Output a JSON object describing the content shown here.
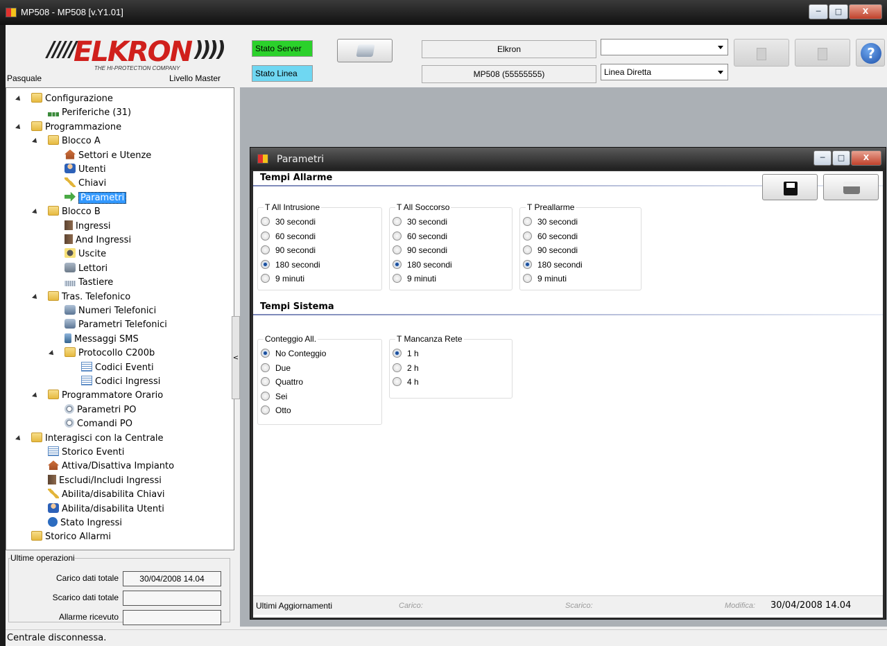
{
  "window": {
    "title": "MP508 - MP508 [v.Y1.01]"
  },
  "header": {
    "logo_text": "ELKRON",
    "logo_tagline": "THE HI-PROTECTION COMPANY",
    "user": "Pasquale",
    "level": "Livello Master",
    "stato_server": "Stato Server",
    "stato_linea": "Stato Linea",
    "stato_server_color": "#2bd12b",
    "stato_linea_color": "#6fd7f2",
    "central_name": "Elkron",
    "central_model": "MP508 (55555555)",
    "combo1_value": "",
    "line_type": "Linea Diretta"
  },
  "tree": [
    {
      "label": "Configurazione",
      "icon": "folder-icon"
    },
    {
      "label": "Periferiche (31)",
      "icon": "network-icon"
    },
    {
      "label": "Programmazione",
      "icon": "folder-icon"
    },
    {
      "label": "Blocco A",
      "icon": "folder-icon"
    },
    {
      "label": "Settori e Utenze",
      "icon": "house-icon"
    },
    {
      "label": "Utenti",
      "icon": "user-icon"
    },
    {
      "label": "Chiavi",
      "icon": "key-icon"
    },
    {
      "label": "Parametri",
      "icon": "green-arrow-icon"
    },
    {
      "label": "Blocco B",
      "icon": "folder-icon"
    },
    {
      "label": "Ingressi",
      "icon": "door-icon"
    },
    {
      "label": "And Ingressi",
      "icon": "door-icon"
    },
    {
      "label": "Uscite",
      "icon": "speaker-icon"
    },
    {
      "label": "Lettori",
      "icon": "reader-icon"
    },
    {
      "label": "Tastiere",
      "icon": "keyboard-icon"
    },
    {
      "label": "Tras. Telefonico",
      "icon": "folder-icon"
    },
    {
      "label": "Numeri Telefonici",
      "icon": "phone-icon"
    },
    {
      "label": "Parametri Telefonici",
      "icon": "phone-icon"
    },
    {
      "label": "Messaggi SMS",
      "icon": "sms-icon"
    },
    {
      "label": "Protocollo C200b",
      "icon": "folder-icon"
    },
    {
      "label": "Codici Eventi",
      "icon": "table-icon"
    },
    {
      "label": "Codici Ingressi",
      "icon": "table-icon"
    },
    {
      "label": "Programmatore Orario",
      "icon": "folder-icon"
    },
    {
      "label": "Parametri PO",
      "icon": "clock-icon"
    },
    {
      "label": "Comandi PO",
      "icon": "clock-icon"
    },
    {
      "label": "Interagisci con la Centrale",
      "icon": "folder-icon"
    },
    {
      "label": "Storico Eventi",
      "icon": "log-icon"
    },
    {
      "label": "Attiva/Disattiva Impianto",
      "icon": "house-icon"
    },
    {
      "label": "Escludi/Includi Ingressi",
      "icon": "door-icon"
    },
    {
      "label": "Abilita/disabilita Chiavi",
      "icon": "key-icon"
    },
    {
      "label": "Abilita/disabilita Utenti",
      "icon": "user-icon"
    },
    {
      "label": "Stato Ingressi",
      "icon": "info-icon"
    },
    {
      "label": "Storico Allarmi",
      "icon": "folder-icon"
    }
  ],
  "recent": {
    "title": "Ultime operazioni",
    "carico_label": "Carico dati totale",
    "carico_value": "30/04/2008 14.04",
    "scarico_label": "Scarico dati totale",
    "scarico_value": "",
    "allarme_label": "Allarme ricevuto",
    "allarme_value": ""
  },
  "status": {
    "text": "Centrale disconnessa."
  },
  "splitter": {
    "label": "<"
  },
  "child": {
    "title": "Parametri",
    "section1": "Tempi Allarme",
    "section2": "Tempi Sistema",
    "groups": {
      "intrusione": {
        "label": "T All Intrusione",
        "options": [
          "30 secondi",
          "60 secondi",
          "90 secondi",
          "180 secondi",
          "9 minuti"
        ],
        "selected": "180 secondi"
      },
      "soccorso": {
        "label": "T All Soccorso",
        "options": [
          "30 secondi",
          "60 secondi",
          "90 secondi",
          "180 secondi",
          "9 minuti"
        ],
        "selected": "180 secondi"
      },
      "preallarme": {
        "label": "T Preallarme",
        "options": [
          "30 secondi",
          "60 secondi",
          "90 secondi",
          "180 secondi",
          "9 minuti"
        ],
        "selected": "180 secondi"
      },
      "conteggio": {
        "label": "Conteggio All.",
        "options": [
          "No Conteggio",
          "Due",
          "Quattro",
          "Sei",
          "Otto"
        ],
        "selected": "No Conteggio"
      },
      "mancanza": {
        "label": "T Mancanza Rete",
        "options": [
          "1 h",
          "2 h",
          "4 h"
        ],
        "selected": "1 h"
      }
    },
    "footer": {
      "label": "Ultimi Aggiornamenti",
      "carico": "Carico:",
      "scarico": "Scarico:",
      "modifica": "Modifica:",
      "modifica_value": "30/04/2008 14.04"
    }
  }
}
